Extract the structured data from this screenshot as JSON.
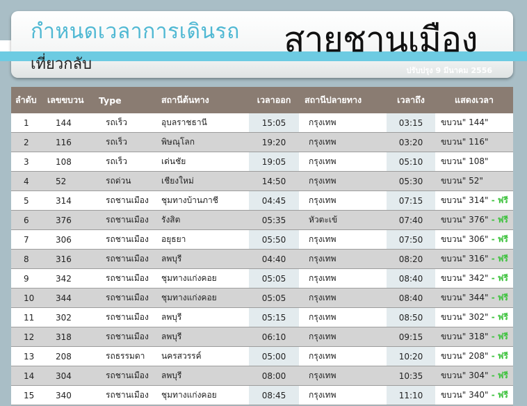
{
  "header": {
    "title_main": "กำหนดเวลาการเดินรถ",
    "title_sub": "เที่ยวกลับ",
    "title_big": "สายชานเมือง",
    "updated": "ปรับปรุง 9 มีนาคม 2556"
  },
  "colors": {
    "accent_cyan": "#6dcbe2",
    "header_brown": "#8a7c72",
    "express_green": "#1f7a2e",
    "rapid_pink": "#e0208a",
    "free_green": "#3ec23e"
  },
  "table": {
    "columns": [
      "ลำดับ",
      "เลขขบวน",
      "Type",
      "สถานีต้นทาง",
      "เวลาออก",
      "สถานีปลายทาง",
      "เวลาถึง",
      "แสดงเวลา"
    ],
    "rows": [
      {
        "no": "1",
        "train": "144",
        "type": "รถเร็ว",
        "from": "อุบลราชธานี",
        "dep": "15:05",
        "to": "กรุงเทพ",
        "arr": "03:15",
        "show": "ขบวน\" 144\"",
        "free": "",
        "style": "green"
      },
      {
        "no": "2",
        "train": "116",
        "type": "รถเร็ว",
        "from": "พิษณุโลก",
        "dep": "19:20",
        "to": "กรุงเทพ",
        "arr": "03:20",
        "show": "ขบวน\" 116\"",
        "free": "",
        "style": "green"
      },
      {
        "no": "3",
        "train": "108",
        "type": "รถเร็ว",
        "from": "เด่นชัย",
        "dep": "19:05",
        "to": "กรุงเทพ",
        "arr": "05:10",
        "show": "ขบวน\" 108\"",
        "free": "",
        "style": "green"
      },
      {
        "no": "4",
        "train": "52",
        "type": "รถด่วน",
        "from": "เชียงใหม่",
        "dep": "14:50",
        "to": "กรุงเทพ",
        "arr": "05:30",
        "show": "ขบวน\" 52\"",
        "free": "",
        "style": "pink"
      },
      {
        "no": "5",
        "train": "314",
        "type": "รถชานเมือง",
        "from": "ชุมทางบ้านภาชี",
        "dep": "04:45",
        "to": "กรุงเทพ",
        "arr": "07:15",
        "show": "ขบวน\" 314\"",
        "free": " - ฟรี",
        "style": ""
      },
      {
        "no": "6",
        "train": "376",
        "type": "รถชานเมือง",
        "from": "รังสิต",
        "dep": "05:35",
        "to": "หัวตะเข้",
        "arr": "07:40",
        "show": "ขบวน\" 376\"",
        "free": " - ฟรี",
        "style": ""
      },
      {
        "no": "7",
        "train": "306",
        "type": "รถชานเมือง",
        "from": "อยุธยา",
        "dep": "05:50",
        "to": "กรุงเทพ",
        "arr": "07:50",
        "show": "ขบวน\" 306\"",
        "free": " - ฟรี",
        "style": ""
      },
      {
        "no": "8",
        "train": "316",
        "type": "รถชานเมือง",
        "from": "ลพบุรี",
        "dep": "04:40",
        "to": "กรุงเทพ",
        "arr": "08:20",
        "show": "ขบวน\" 316\"",
        "free": " - ฟรี",
        "style": ""
      },
      {
        "no": "9",
        "train": "342",
        "type": "รถชานเมือง",
        "from": "ชุมทางแก่งคอย",
        "dep": "05:05",
        "to": "กรุงเทพ",
        "arr": "08:40",
        "show": "ขบวน\" 342\"",
        "free": " - ฟรี",
        "style": ""
      },
      {
        "no": "10",
        "train": "344",
        "type": "รถชานเมือง",
        "from": "ชุมทางแก่งคอย",
        "dep": "05:05",
        "to": "กรุงเทพ",
        "arr": "08:40",
        "show": "ขบวน\" 344\"",
        "free": " - ฟรี",
        "style": ""
      },
      {
        "no": "11",
        "train": "302",
        "type": "รถชานเมือง",
        "from": "ลพบุรี",
        "dep": "05:15",
        "to": "กรุงเทพ",
        "arr": "08:50",
        "show": "ขบวน\" 302\"",
        "free": " - ฟรี",
        "style": ""
      },
      {
        "no": "12",
        "train": "318",
        "type": "รถชานเมือง",
        "from": "ลพบุรี",
        "dep": "06:10",
        "to": "กรุงเทพ",
        "arr": "09:15",
        "show": "ขบวน\" 318\"",
        "free": " - ฟรี",
        "style": ""
      },
      {
        "no": "13",
        "train": "208",
        "type": "รถธรรมดา",
        "from": "นครสวรรค์",
        "dep": "05:00",
        "to": "กรุงเทพ",
        "arr": "10:20",
        "show": "ขบวน\" 208\"",
        "free": " - ฟรี",
        "style": ""
      },
      {
        "no": "14",
        "train": "304",
        "type": "รถชานเมือง",
        "from": "ลพบุรี",
        "dep": "08:00",
        "to": "กรุงเทพ",
        "arr": "10:35",
        "show": "ขบวน\" 304\"",
        "free": " - ฟรี",
        "style": ""
      },
      {
        "no": "15",
        "train": "340",
        "type": "รถชานเมือง",
        "from": "ชุมทางแก่งคอย",
        "dep": "08:45",
        "to": "กรุงเทพ",
        "arr": "11:10",
        "show": "ขบวน\" 340\"",
        "free": " - ฟรี",
        "style": ""
      }
    ]
  }
}
